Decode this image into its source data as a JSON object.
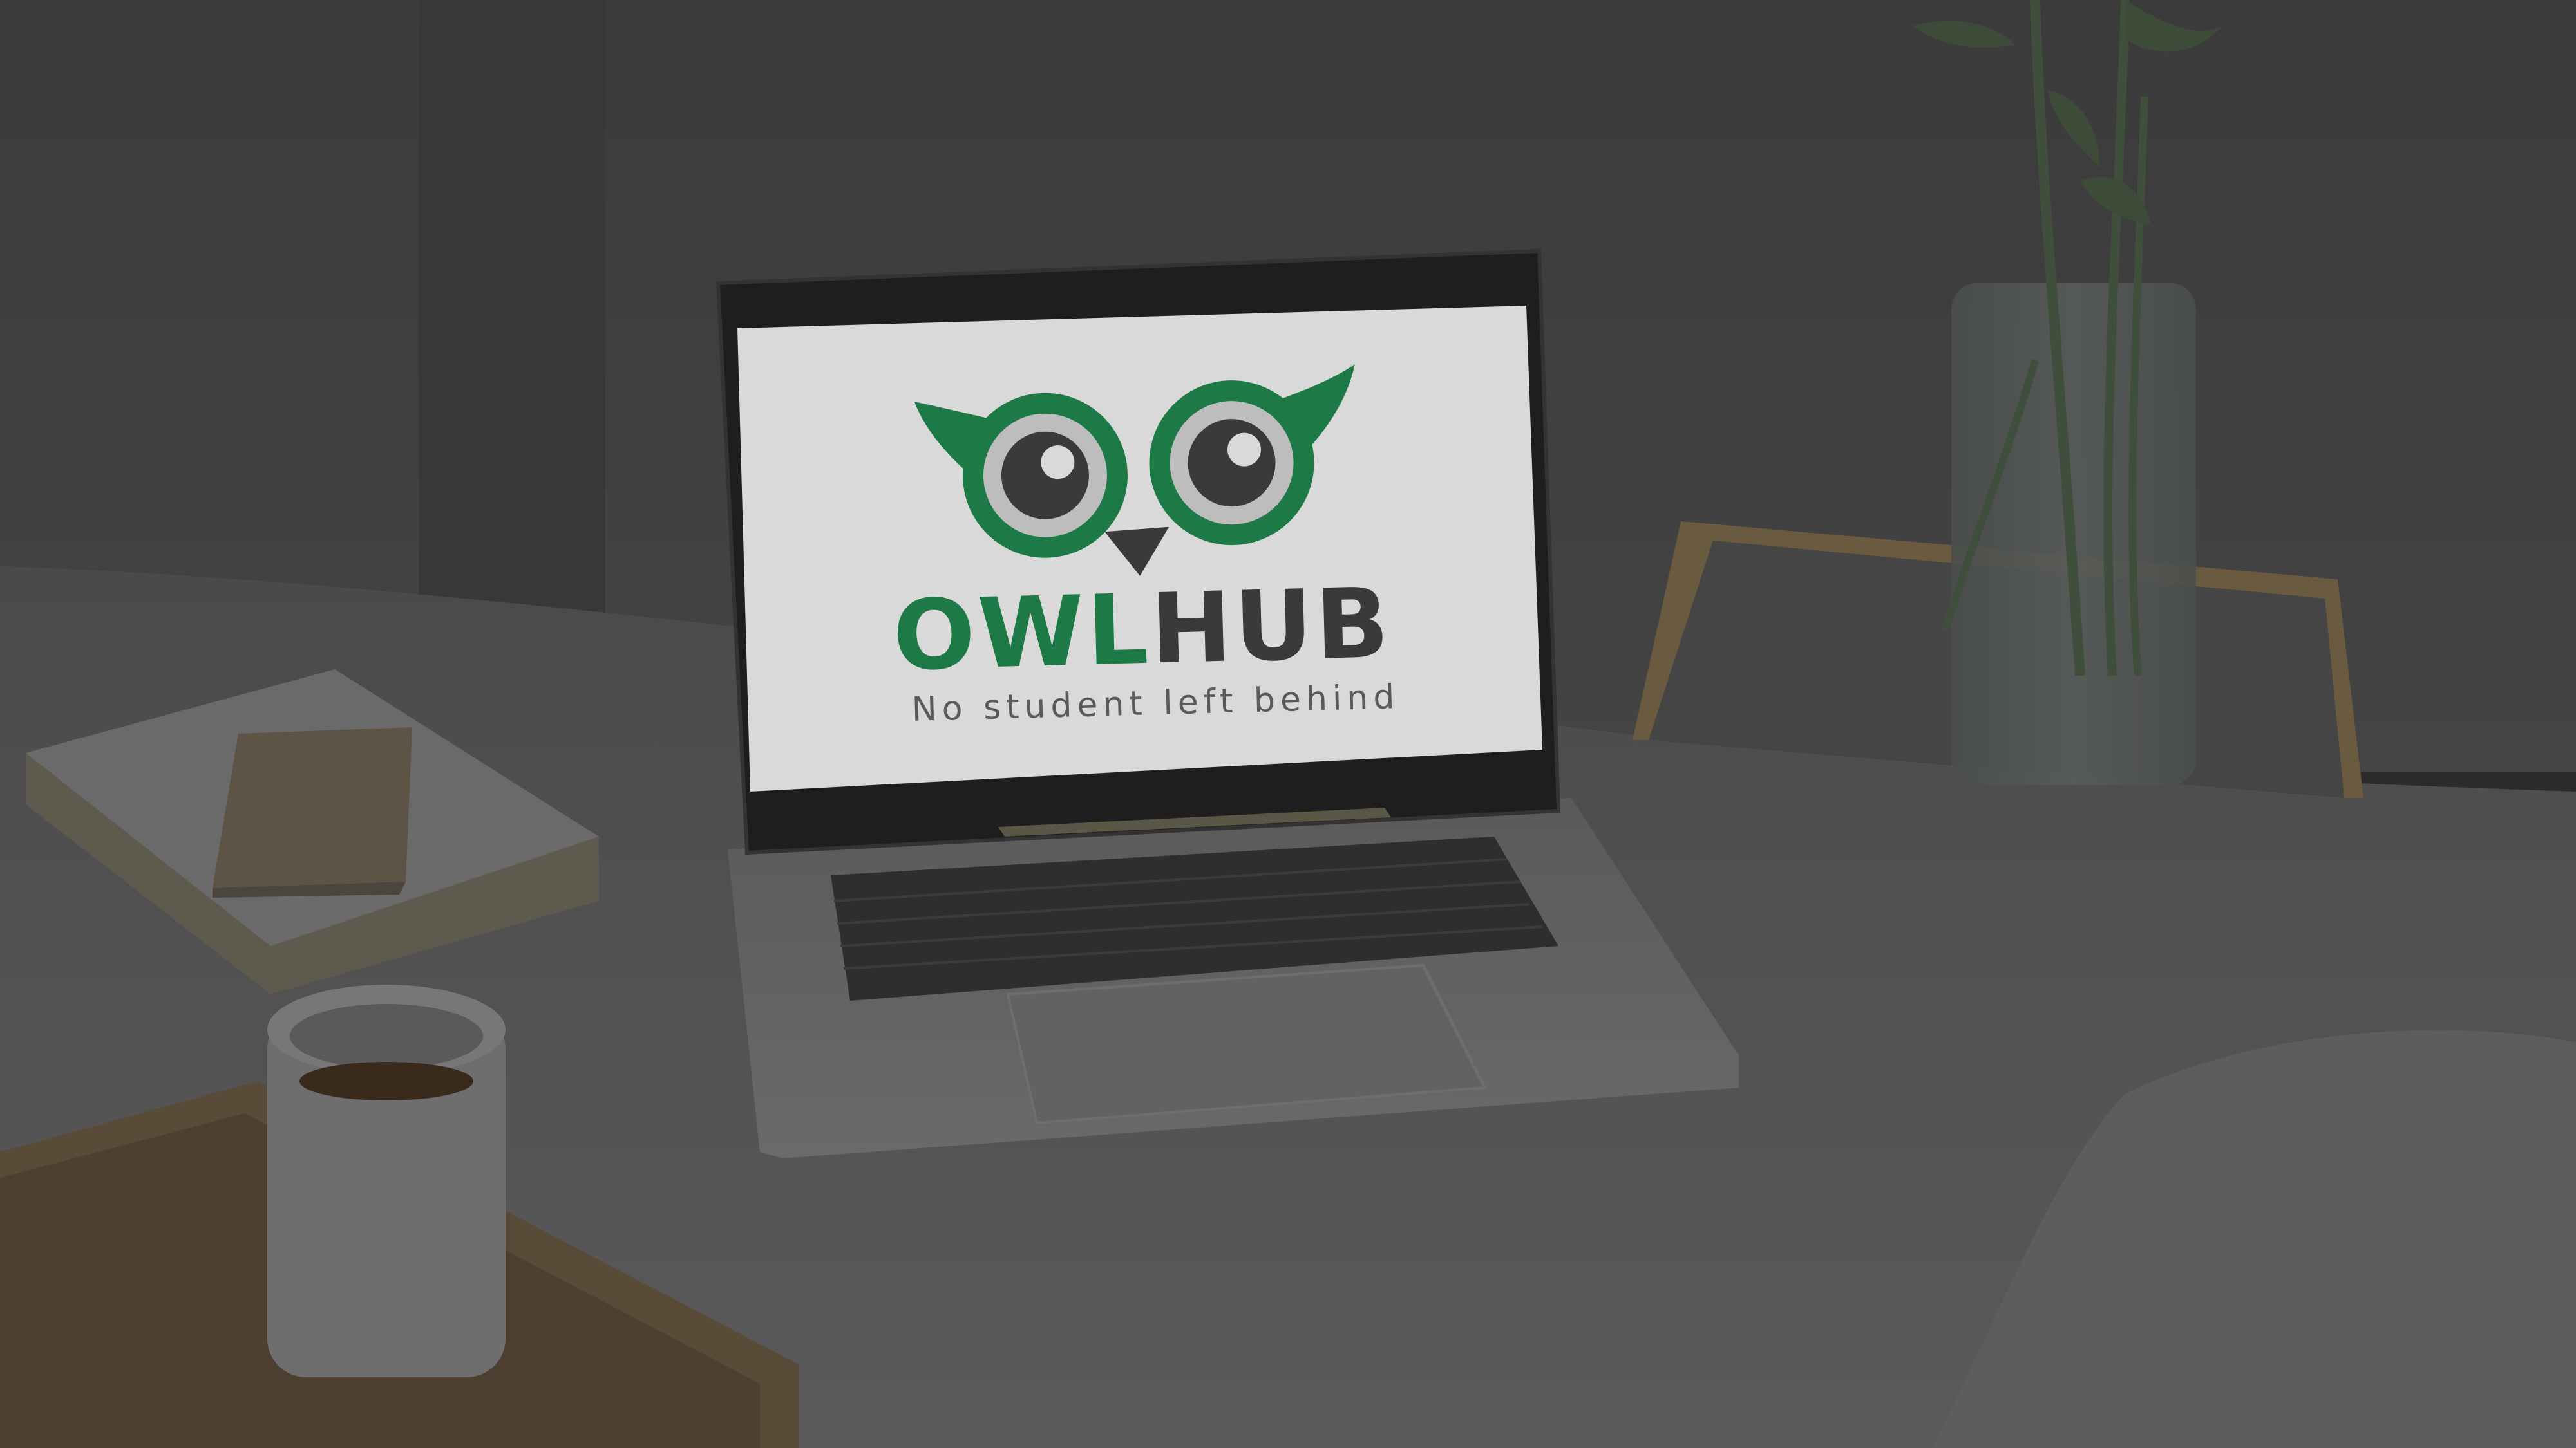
{
  "screen": {
    "brand_part1": "OWL",
    "brand_part2": "HUB",
    "tagline": "No student left behind"
  },
  "colors": {
    "brand_green": "#1d7a46",
    "brand_dark": "#3a3a3a",
    "tagline": "#5a5a5a",
    "screen_bg": "#d9d9d9"
  },
  "icons": {
    "logo": "owl-face-icon"
  }
}
